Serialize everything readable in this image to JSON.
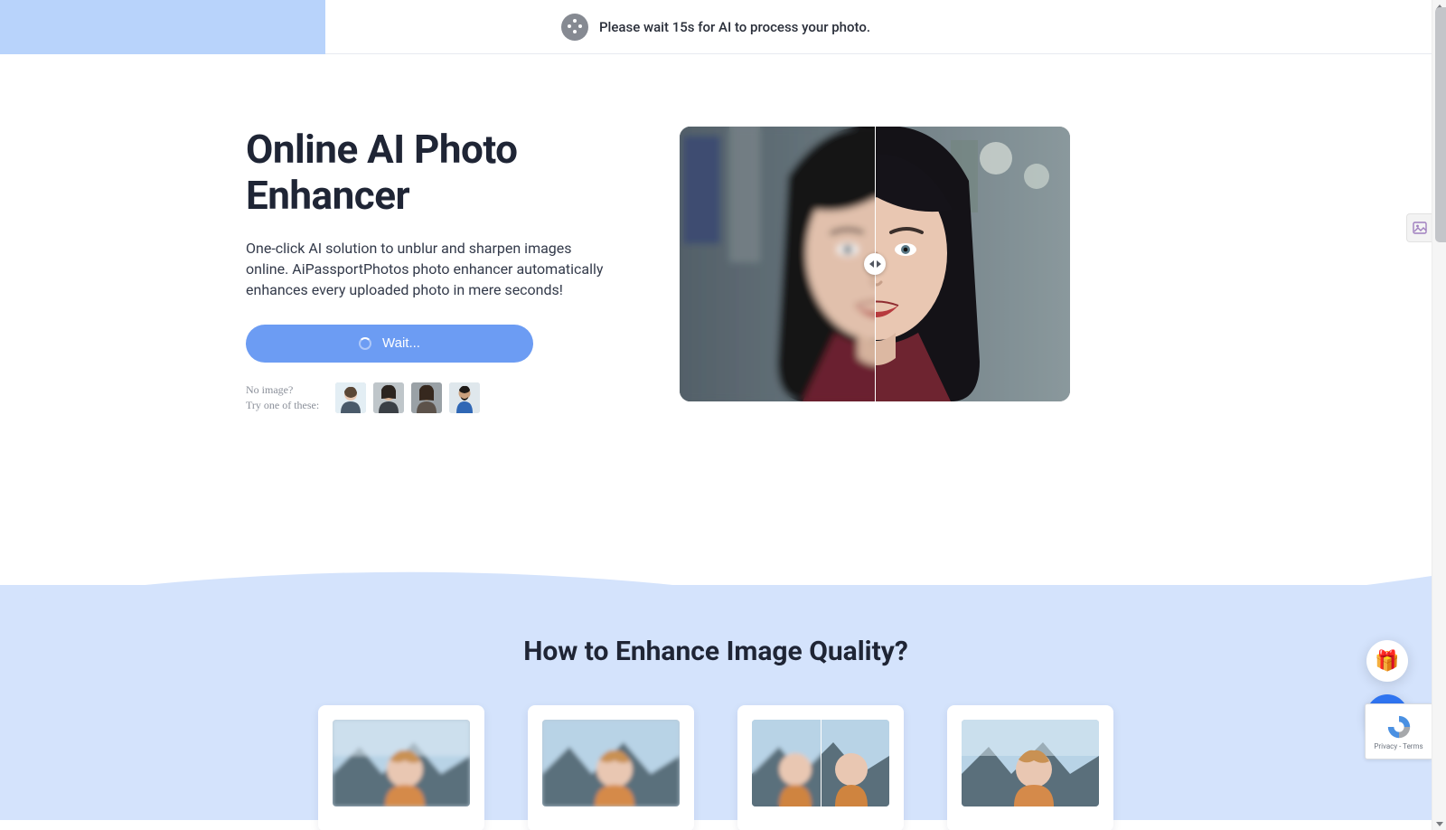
{
  "topbar": {
    "message": "Please wait 15s for AI to process your photo."
  },
  "hero": {
    "title": "Online AI Photo Enhancer",
    "description": "One-click AI solution to unblur and sharpen images online. AiPassportPhotos photo enhancer automatically enhances every uploaded photo in mere seconds!",
    "wait_button": "Wait...",
    "sample_prompt_line1": "No image?",
    "sample_prompt_line2": "Try one of these:"
  },
  "section2": {
    "title": "How to Enhance Image Quality?"
  },
  "recaptcha": {
    "terms": "Privacy - Terms"
  },
  "colors": {
    "accent": "#6c9cf3",
    "light_blue": "#d4e3fc",
    "loader": "#b8d3fb"
  }
}
